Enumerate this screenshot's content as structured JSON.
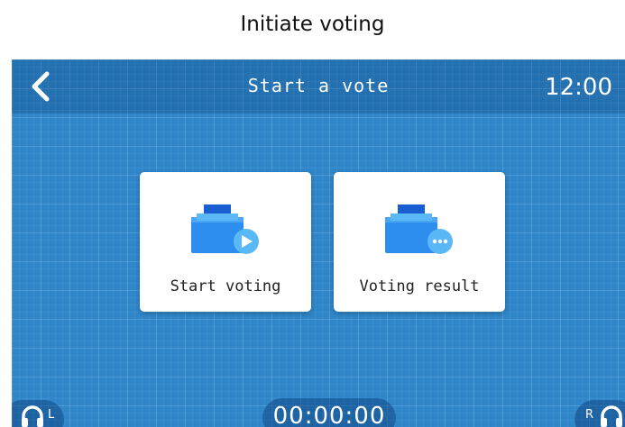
{
  "caption": "Initiate voting",
  "header": {
    "title": "Start a vote",
    "time": "12:00",
    "back_icon": "chevron-left-icon"
  },
  "cards": [
    {
      "label": "Start voting",
      "icon": "ballot-box-play-icon"
    },
    {
      "label": "Voting result",
      "icon": "ballot-box-more-icon"
    }
  ],
  "footer": {
    "left_channel": "L",
    "right_channel": "R",
    "timer": "00:00:00",
    "headphone_icon": "headphones-icon"
  },
  "colors": {
    "screen_bg": "#2f86c9",
    "icon_blue": "#2d8ef0",
    "icon_dark": "#1a5fd1",
    "icon_light": "#5bb8f7"
  }
}
